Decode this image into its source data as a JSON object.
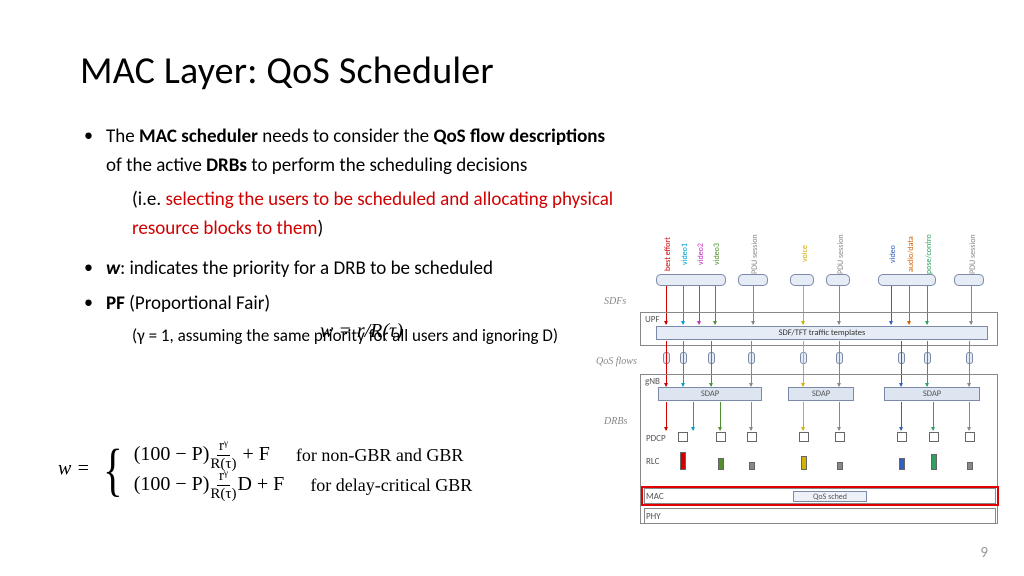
{
  "title": "MAC Layer: QoS Scheduler",
  "bullets": {
    "b1_pre": "The ",
    "b1_mac": "MAC scheduler",
    "b1_mid": " needs to consider the ",
    "b1_qos": "QoS flow descriptions",
    "b1_mid2": " of the active ",
    "b1_drb": "DRBs",
    "b1_post": " to perform the scheduling decisions",
    "b1_sub_pre": "(i.e. ",
    "b1_sub_red": "selecting the users to be scheduled and allocating physical resource blocks to them",
    "b1_sub_post": ")",
    "b2_w": "w",
    "b2_text": ": indicates the priority for a DRB to be scheduled",
    "b3_pf": "PF",
    "b3_text": " (Proportional Fair)",
    "b3_sub": "(γ = 1, assuming the same priority for all users and ignoring D)"
  },
  "formula_inline": "w = r/R(τ)",
  "formula": {
    "lhs": "w =",
    "row1_a": "(100 − P)",
    "row1_num": "rᵞ",
    "row1_den": "R(τ)",
    "row1_b": " + F",
    "row1_txt": "for non-GBR and GBR",
    "row2_a": "(100 − P)",
    "row2_num": "rᵞ",
    "row2_den": "R(τ)",
    "row2_b": "D + F",
    "row2_txt": "for delay-critical GBR"
  },
  "diagram": {
    "sdfs": "SDFs",
    "qosflows": "QoS flows",
    "drbs": "DRBs",
    "upf": "UPF",
    "tft": "SDF/TFT traffic templates",
    "gnb": "gNB",
    "sdap": "SDAP",
    "pdcp": "PDCP",
    "rlc": "RLC",
    "mac": "MAC",
    "phy": "PHY",
    "qos_sched": "QoS sched",
    "vlabels": [
      "best effort",
      "video1",
      "video2",
      "video3",
      "PDU session",
      "voice",
      "PDU session",
      "video",
      "audio/data",
      "pose/contro",
      "PDU session"
    ]
  },
  "colors": {
    "v": [
      "#d47a00",
      "#d00000",
      "#00a0d4",
      "#c030c0",
      "#509030",
      "#888",
      "#d4b000",
      "#888",
      "#3060c0",
      "#d46000",
      "#30a060",
      "#888"
    ]
  },
  "page_number": "9"
}
